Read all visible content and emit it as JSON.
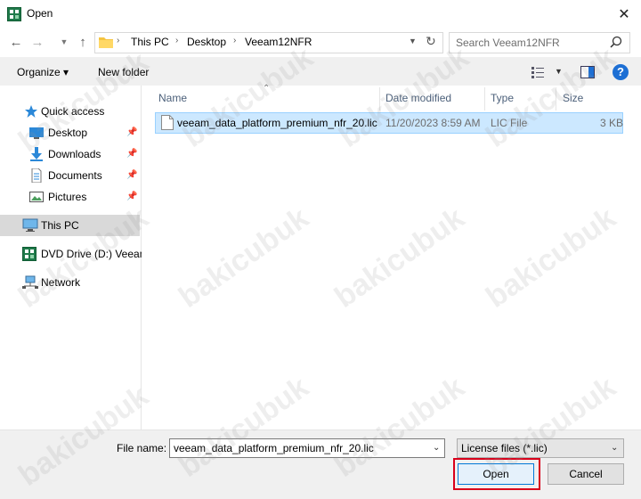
{
  "window": {
    "title": "Open"
  },
  "address": {
    "crumbs": [
      "This PC",
      "Desktop",
      "Veeam12NFR"
    ],
    "search_placeholder": "Search Veeam12NFR"
  },
  "toolbar": {
    "organize": "Organize ▾",
    "new_folder": "New folder"
  },
  "nav": {
    "quick_access": "Quick access",
    "desktop": "Desktop",
    "downloads": "Downloads",
    "documents": "Documents",
    "pictures": "Pictures",
    "this_pc": "This PC",
    "dvd": "DVD Drive (D:) Veeam",
    "network": "Network"
  },
  "columns": {
    "name": "Name",
    "date": "Date modified",
    "type": "Type",
    "size": "Size"
  },
  "files": [
    {
      "name": "veeam_data_platform_premium_nfr_20.lic",
      "date": "11/20/2023 8:59 AM",
      "type": "LIC File",
      "size": "3 KB"
    }
  ],
  "bottom": {
    "filename_label": "File name:",
    "filename_value": "veeam_data_platform_premium_nfr_20.lic",
    "filetype_value": "License files (*.lic)",
    "open": "Open",
    "cancel": "Cancel"
  },
  "watermark": "bakicubuk",
  "colors": {
    "selection": "#cce8ff",
    "accent": "#0078d7",
    "highlight_box": "#d9001b",
    "help": "#1d6fd4"
  },
  "icons": [
    "app-icon",
    "close-icon",
    "back-icon",
    "forward-icon",
    "dropdown-icon",
    "up-icon",
    "folder-icon",
    "refresh-icon",
    "search-icon",
    "view-icon",
    "preview-pane-icon",
    "help-icon",
    "star-icon",
    "desktop-icon",
    "download-icon",
    "document-icon",
    "pictures-icon",
    "pc-icon",
    "dvd-icon",
    "network-icon",
    "pin-icon",
    "file-icon"
  ]
}
